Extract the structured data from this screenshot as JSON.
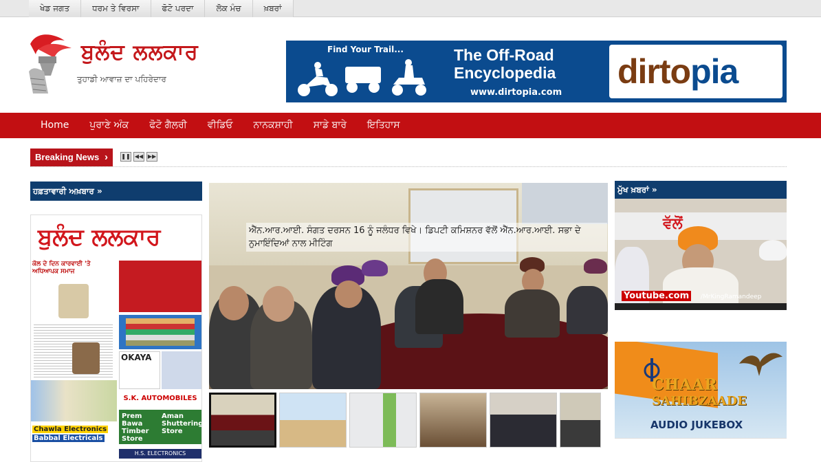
{
  "topbar": {
    "tabs": [
      "ਖੇਡ ਜਗਤ",
      "ਧਰਮ ਤੇ ਵਿਰਸਾ",
      "ਫੋਟੋ ਪਰਦਾ",
      "ਲੋਕ ਮੰਚ",
      "ਖ਼ਬਰਾਂ"
    ]
  },
  "header": {
    "logo_title": "ਬੁਲੰਦ ਲਲਕਾਰ",
    "logo_subtitle": "ਤੁਹਾਡੀ ਆਵਾਜ਼ ਦਾ ਪਹਿਰੇਦਾਰ"
  },
  "ad": {
    "tagline": "Find Your Trail...",
    "headline_line1": "The Off-Road",
    "headline_line2": "Encyclopedia",
    "url": "www.dirtopia.com",
    "brand_part1": "dirto",
    "brand_part2": "pia"
  },
  "nav": {
    "items": [
      "Home",
      "ਪੁਰਾਣੇ ਅੰਕ",
      "ਫੋਟੋ ਗੈਲਰੀ",
      "ਵੀਡਿਓ",
      "ਨਾਨਕਸ਼ਾਹੀ",
      "ਸਾਡੇ ਬਾਰੇ",
      "ਇਤਿਹਾਸ"
    ]
  },
  "breaking": {
    "label": "Breaking News",
    "chevron": "›",
    "controls": [
      "pause-icon",
      "prev-icon",
      "next-icon"
    ]
  },
  "left": {
    "heading": "ਹਫ਼ਤਾਵਾਰੀ ਅਖ਼ਬਾਰ »",
    "paper_masthead": "ਬੁਲੰਦ ਲਲਕਾਰ",
    "paper_headline": "ਕੋਲ ਦੇ ਦਿਨ ਕਾਰਵਾਈ 'ਤੇ ਅਧਿਆਪਕ ਸਮਾਜ",
    "okaya": "OKAYA",
    "sk": "S.K. AUTOMOBILES",
    "prem": "Prem Bawa Timber Store",
    "aman": "Aman Shuttering Store",
    "chawla1": "Chawla Electronics",
    "chawla2": "Babbal Electricals",
    "hs": "H.S. ELECTRONICS"
  },
  "feature": {
    "caption": "ਐੱਨ.ਆਰ.ਆਈ. ਸੰਗਤ ਦਰਸਨ 16 ਨੂੰ ਜਲੰਧਰ ਵਿਖੇ। ਡਿਪਟੀ ਕਮਿਸ਼ਨਰ ਵੱਲੋਂ ਐੱਨ.ਆਰ.ਆਈ. ਸਭਾ ਦੇ ਨੁਮਾਇੰਦਿਆਂ ਨਾਲ ਮੀਟਿੰਗ"
  },
  "right": {
    "heading": "ਮੁੱਖ ਖ਼ਬਰਾਂ »",
    "video1_title": "ਵੱਲੋਂ",
    "video1_youtube": "Youtube.com",
    "video1_channel": "/MrKingRamandeep",
    "video2_title1": "CHAAR",
    "video2_title2": "SAHIBZAADE",
    "video2_sub": "AUDIO JUKEBOX"
  },
  "colors": {
    "brand_red": "#c20f12",
    "navy": "#0f3d6e",
    "ad_blue": "#0b4b8f"
  }
}
